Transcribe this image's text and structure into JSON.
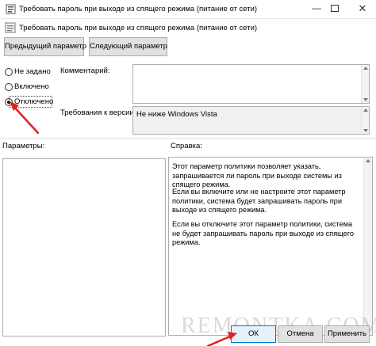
{
  "window": {
    "title": "Требовать пароль при выходе из спящего режима (питание от сети)",
    "subtitle": "Требовать пароль при выходе из спящего режима (питание от сети)",
    "minimize_glyph": "—",
    "close_glyph": "✕"
  },
  "nav": {
    "prev_label": "Предыдущий параметр",
    "next_label": "Следующий параметр"
  },
  "options": {
    "items": [
      {
        "label": "Не задано",
        "checked": false
      },
      {
        "label": "Включено",
        "checked": false
      },
      {
        "label": "Отключено",
        "checked": true
      }
    ]
  },
  "fields": {
    "comment_label": "Комментарий:",
    "comment_value": "",
    "version_label": "Требования к версии:",
    "version_value": "Не ниже Windows Vista"
  },
  "sections": {
    "params_label": "Параметры:",
    "help_label": "Справка:"
  },
  "help": {
    "paragraphs": [
      "Этот параметр политики позволяет указать, запрашивается ли пароль при выходе системы из спящего режима.",
      "Если вы включите или не настроите этот параметр политики, система будет запрашивать пароль при выходе из спящего режима.",
      "Если вы отключите этот параметр политики, система не будет запрашивать пароль при выходе из спящего режима."
    ]
  },
  "footer": {
    "ok_label": "ОК",
    "cancel_label": "Отмена",
    "apply_label": "Применить"
  },
  "watermark": "REMONTKA.COM",
  "colors": {
    "annotation_arrow": "#e02020",
    "focus_border": "#0078d7"
  }
}
